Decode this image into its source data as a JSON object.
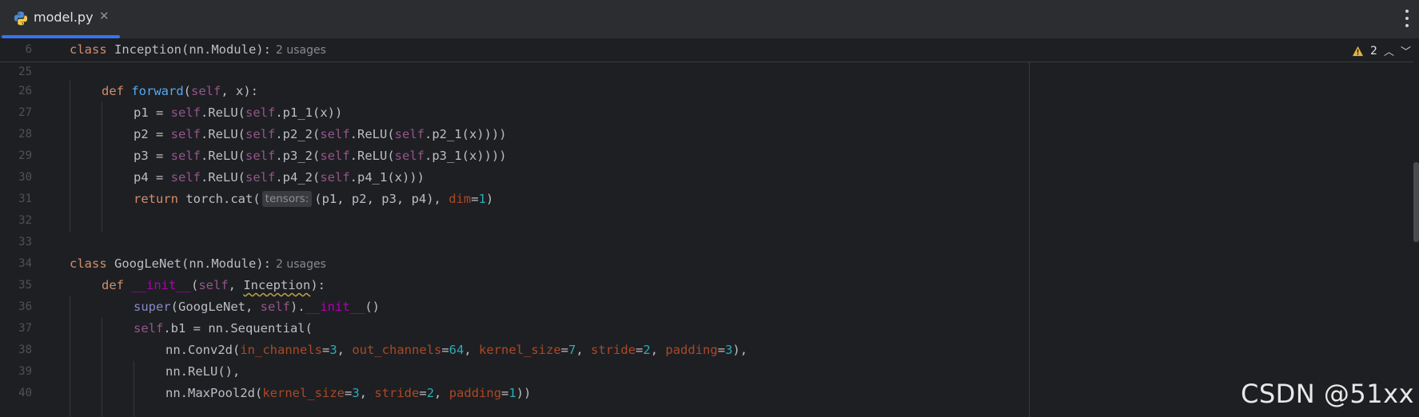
{
  "tab": {
    "file_name": "model.py",
    "close_glyph": "✕",
    "icon": "python-file-icon"
  },
  "inspection": {
    "warning_count": "2",
    "up_glyph": "︿",
    "down_glyph": "﹀"
  },
  "sticky": {
    "line_number": "6",
    "keyword": "class",
    "rest": " Inception(nn.Module):",
    "usages": "2 usages"
  },
  "gutter": [
    "25",
    "26",
    "27",
    "28",
    "29",
    "30",
    "31",
    "32",
    "33",
    "34",
    "35",
    "36",
    "37",
    "38",
    "39",
    "40"
  ],
  "code": {
    "l26": {
      "kw": "def",
      "fn": "forward",
      "p1": "(",
      "self": "self",
      "p2": ", x):"
    },
    "l27": {
      "a": "p1 = ",
      "s1": "self",
      "b": ".ReLU(",
      "s2": "self",
      "c": ".p1_1(x))"
    },
    "l28": {
      "a": "p2 = ",
      "s1": "self",
      "b": ".ReLU(",
      "s2": "self",
      "c": ".p2_2(",
      "s3": "self",
      "d": ".ReLU(",
      "s4": "self",
      "e": ".p2_1(x))))"
    },
    "l29": {
      "a": "p3 = ",
      "s1": "self",
      "b": ".ReLU(",
      "s2": "self",
      "c": ".p3_2(",
      "s3": "self",
      "d": ".ReLU(",
      "s4": "self",
      "e": ".p3_1(x))))"
    },
    "l30": {
      "a": "p4 = ",
      "s1": "self",
      "b": ".ReLU(",
      "s2": "self",
      "c": ".p4_2(",
      "s3": "self",
      "d": ".p4_1(x)))"
    },
    "l31": {
      "kw": "return",
      "a": " torch.cat(",
      "hint": "tensors:",
      "b": "(p1, p2, p3, p4), ",
      "par": "dim",
      "eq": "=",
      "num": "1",
      "c": ")"
    },
    "l34": {
      "kw": "class",
      "a": " GoogLeNet(nn.Module):",
      "usages": "2 usages"
    },
    "l35": {
      "kw": "def",
      "mg": "__init__",
      "p1": "(",
      "self": "self",
      "p2": ", ",
      "warn": "Inception",
      "p3": "):"
    },
    "l36": {
      "bi": "super",
      "a": "(GoogLeNet, ",
      "self": "self",
      "b": ").",
      "mg": "__init__",
      "c": "()"
    },
    "l37": {
      "self": "self",
      "a": ".b1 = nn.Sequential("
    },
    "l38": {
      "a": "nn.Conv2d(",
      "p_in": "in_channels",
      "v_in": "3",
      "sep1": ", ",
      "p_out": "out_channels",
      "v_out": "64",
      "sep2": ", ",
      "p_ks": "kernel_size",
      "v_ks": "7",
      "sep3": ", ",
      "p_st": "stride",
      "v_st": "2",
      "sep4": ", ",
      "p_pad": "padding",
      "v_pad": "3",
      "end": "),"
    },
    "l39": {
      "a": "nn.ReLU(),"
    },
    "l40": {
      "a": "nn.MaxPool2d(",
      "p_ks": "kernel_size",
      "v_ks": "3",
      "sep1": ", ",
      "p_st": "stride",
      "v_st": "2",
      "sep2": ", ",
      "p_pad": "padding",
      "v_pad": "1",
      "end": "))"
    }
  },
  "watermark": "CSDN @51xx",
  "colors": {
    "keyword": "#cf8e6d",
    "self": "#94558d",
    "function": "#56a8f5",
    "magic": "#b200b2",
    "number": "#2aacb8",
    "param": "#aa4926",
    "accent": "#3574f0"
  }
}
